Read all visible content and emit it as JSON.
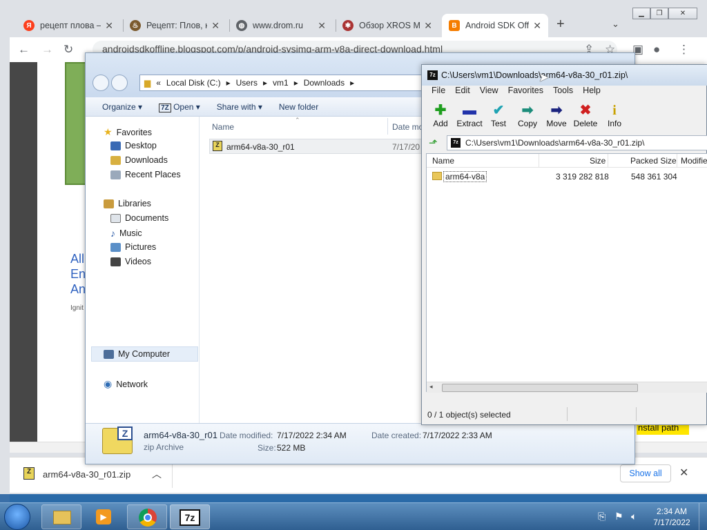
{
  "browser": {
    "tabs": [
      {
        "title": "рецепт плова —",
        "icon": "yandex-icon",
        "color": "#fc3f1d",
        "glyph": "Я"
      },
      {
        "title": "Рецепт: Плов, к",
        "icon": "recipe-icon",
        "color": "#7b5a2e",
        "glyph": "♨"
      },
      {
        "title": "www.drom.ru",
        "icon": "globe-icon",
        "color": "#5f6368",
        "glyph": "◍"
      },
      {
        "title": "Обзор XROS MI",
        "icon": "xros-icon",
        "color": "#a33",
        "glyph": "✱"
      },
      {
        "title": "Android SDK Off",
        "icon": "blogger-icon",
        "color": "#f57d00",
        "glyph": "B"
      }
    ],
    "url": "androidsdkoffline.blogspot.com/p/android-sysimg-arm-v8a-direct-download.html",
    "page_text": {
      "l1": "All",
      "l2": "En",
      "l3": "An",
      "l4": "Ignit",
      "install": "nstall path"
    },
    "download_shelf": {
      "file": "arm64-v8a-30_r01.zip",
      "show_all": "Show all"
    }
  },
  "explorer": {
    "crumb_prefix": "«",
    "breadcrumb": [
      "Local Disk (C:)",
      "Users",
      "vm1",
      "Downloads"
    ],
    "commands": [
      "Organize",
      "Open",
      "Share with",
      "New folder"
    ],
    "favorites": {
      "header": "Favorites",
      "items": [
        "Desktop",
        "Downloads",
        "Recent Places"
      ]
    },
    "libraries": {
      "header": "Libraries",
      "items": [
        "Documents",
        "Music",
        "Pictures",
        "Videos"
      ]
    },
    "computer": "My Computer",
    "network": "Network",
    "columns": {
      "name": "Name",
      "date": "Date mo"
    },
    "files": [
      {
        "name": "arm64-v8a-30_r01",
        "date": "7/17/20"
      }
    ],
    "details": {
      "name": "arm64-v8a-30_r01",
      "type": "zip Archive",
      "modified_label": "Date modified:",
      "modified": "7/17/2022 2:34 AM",
      "created_label": "Date created:",
      "created": "7/17/2022 2:33 AM",
      "size_label": "Size:",
      "size": "522 MB"
    }
  },
  "sevenzip": {
    "title": "C:\\Users\\vm1\\Downloads\\arm64-v8a-30_r01.zip\\",
    "menu": [
      "File",
      "Edit",
      "View",
      "Favorites",
      "Tools",
      "Help"
    ],
    "tools": [
      {
        "label": "Add",
        "glyph": "✚",
        "color": "#1e9e1e",
        "icon": "add-icon"
      },
      {
        "label": "Extract",
        "glyph": "▬",
        "color": "#2233aa",
        "icon": "extract-icon"
      },
      {
        "label": "Test",
        "glyph": "✔",
        "color": "#1fa3b3",
        "icon": "test-icon"
      },
      {
        "label": "Copy",
        "glyph": "➡",
        "color": "#1b8c7a",
        "icon": "copy-icon"
      },
      {
        "label": "Move",
        "glyph": "➡",
        "color": "#1a237e",
        "icon": "move-icon"
      },
      {
        "label": "Delete",
        "glyph": "✖",
        "color": "#d02020",
        "icon": "delete-icon"
      },
      {
        "label": "Info",
        "glyph": "i",
        "color": "#c8a100",
        "icon": "info-icon"
      }
    ],
    "path": "C:\\Users\\vm1\\Downloads\\arm64-v8a-30_r01.zip\\",
    "columns": {
      "name": "Name",
      "size": "Size",
      "packed": "Packed Size",
      "modified": "Modifie"
    },
    "rows": [
      {
        "name": "arm64-v8a",
        "size": "3 319 282 818",
        "packed": "548 361 304"
      }
    ],
    "status": "0 / 1 object(s) selected"
  },
  "taskbar": {
    "time": "2:34 AM",
    "date": "7/17/2022",
    "sevenzip_label": "7z"
  }
}
